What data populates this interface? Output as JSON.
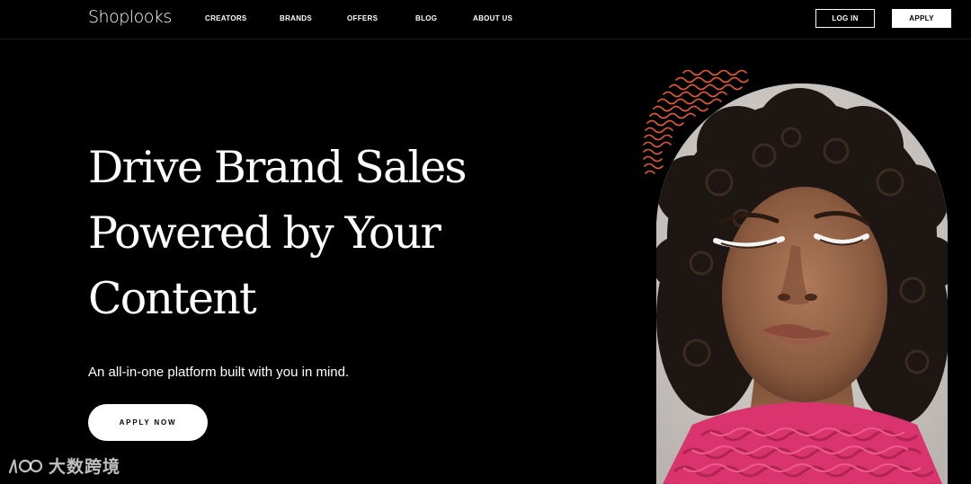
{
  "brand": {
    "logo_text": "Shoplooks"
  },
  "nav": {
    "links": [
      "CREATORS",
      "BRANDS",
      "OFFERS",
      "BLOG",
      "ABOUT US"
    ],
    "login_label": "LOG IN",
    "apply_label": "APPLY"
  },
  "hero": {
    "title_lines": [
      "Drive Brand Sales",
      "Powered by Your",
      "Content"
    ],
    "subtitle": "An all-in-one platform built with you in mind.",
    "cta_label": "APPLY NOW",
    "image": "portrait-woman-pink-knit",
    "decoration": "wavy-lines-orange"
  },
  "watermark": {
    "icon": "watermark-logo-icon",
    "text": "大数跨境"
  },
  "colors": {
    "background": "#000000",
    "text": "#ffffff",
    "accent_orange": "#e0593a",
    "knit_pink": "#d9346e"
  }
}
